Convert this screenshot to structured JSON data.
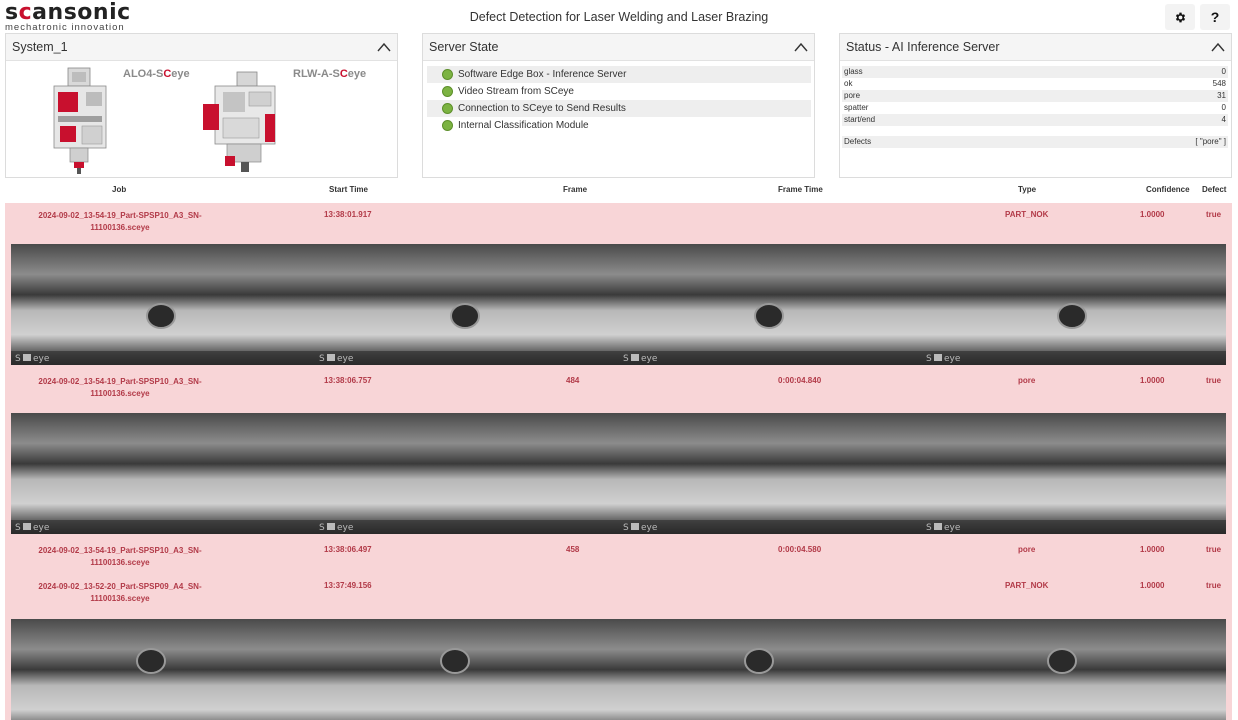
{
  "header": {
    "logo_main": "scansonic",
    "logo_sub": "mechatronic innovation",
    "title": "Defect Detection for Laser Welding and Laser Brazing",
    "settings_icon": "gear-icon",
    "help_label": "?"
  },
  "panels": {
    "system": {
      "title": "System_1",
      "machines": [
        {
          "name_prefix": "ALO4-S",
          "name_mid": "C",
          "name_suffix": "eye"
        },
        {
          "name_prefix": "RLW-A-S",
          "name_mid": "C",
          "name_suffix": "eye"
        }
      ]
    },
    "server_state": {
      "title": "Server State",
      "items": [
        {
          "label": "Software Edge Box - Inference Server"
        },
        {
          "label": "Video Stream from SCeye"
        },
        {
          "label": "Connection to SCeye to Send Results"
        },
        {
          "label": "Internal Classification Module"
        }
      ]
    },
    "status": {
      "title": "Status - AI Inference Server",
      "rows": [
        {
          "label": "glass",
          "value": "0"
        },
        {
          "label": "ok",
          "value": "548"
        },
        {
          "label": "pore",
          "value": "31"
        },
        {
          "label": "spatter",
          "value": "0"
        },
        {
          "label": "start/end",
          "value": "4"
        }
      ],
      "defects_label": "Defects",
      "defects_value": "[ \"pore\" ]"
    }
  },
  "table": {
    "columns": [
      "Job",
      "Start Time",
      "Frame",
      "Frame Time",
      "Type",
      "Confidence",
      "Defect"
    ],
    "rows": [
      {
        "job_line1": "2024-09-02_13-54-19_Part-SPSP10_A3_SN-",
        "job_line2": "11100136.sceye",
        "start": "13:38:01.917",
        "frame": "",
        "frame_time": "",
        "type": "PART_NOK",
        "confidence": "1.0000",
        "defect": "true"
      },
      {
        "job_line1": "2024-09-02_13-54-19_Part-SPSP10_A3_SN-",
        "job_line2": "11100136.sceye",
        "start": "13:38:06.757",
        "frame": "484",
        "frame_time": "0:00:04.840",
        "type": "pore",
        "confidence": "1.0000",
        "defect": "true"
      },
      {
        "job_line1": "2024-09-02_13-54-19_Part-SPSP10_A3_SN-",
        "job_line2": "11100136.sceye",
        "start": "13:38:06.497",
        "frame": "458",
        "frame_time": "0:00:04.580",
        "type": "pore",
        "confidence": "1.0000",
        "defect": "true"
      },
      {
        "job_line1": "2024-09-02_13-52-20_Part-SPSP09_A4_SN-",
        "job_line2": "11100136.sceye",
        "start": "13:37:49.156",
        "frame": "",
        "frame_time": "",
        "type": "PART_NOK",
        "confidence": "1.0000",
        "defect": "true"
      }
    ],
    "watermark": "SCeye"
  }
}
